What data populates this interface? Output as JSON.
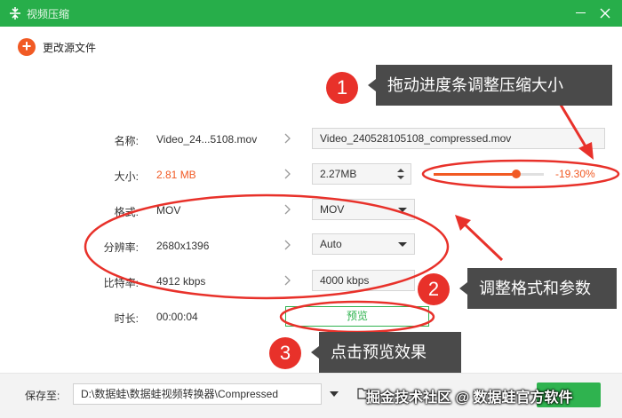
{
  "window": {
    "title": "视频压缩",
    "app_icon": "compress-icon",
    "accent": "#27ae4a"
  },
  "toolbar": {
    "change_source_label": "更改源文件"
  },
  "form": {
    "name": {
      "label": "名称:",
      "source": "Video_24...5108.mov",
      "output": "Video_240528105108_compressed.mov"
    },
    "size": {
      "label": "大小:",
      "source": "2.81 MB",
      "output": "2.27MB",
      "slider_percent": "-19.30%",
      "slider_fraction": 0.75
    },
    "format": {
      "label": "格式:",
      "source": "MOV",
      "output": "MOV"
    },
    "resolution": {
      "label": "分辨率:",
      "source": "2680x1396",
      "output": "Auto"
    },
    "bitrate": {
      "label": "比特率:",
      "source": "4912 kbps",
      "output": "4000 kbps"
    },
    "duration": {
      "label": "时长:",
      "source": "00:00:04"
    },
    "preview_label": "预览"
  },
  "bottom": {
    "save_label": "保存至:",
    "path": "D:\\数据蛙\\数据蛙视频转换器\\Compressed"
  },
  "callouts": [
    {
      "number": "1",
      "text": "拖动进度条调整压缩大小"
    },
    {
      "number": "2",
      "text": "调整格式和参数"
    },
    {
      "number": "3",
      "text": "点击预览效果"
    }
  ],
  "watermark": "掘金技术社区 @ 数据蛙官方软件",
  "colors": {
    "orange": "#f15a24",
    "annotation_red": "#e8312a",
    "callout_bg": "#4a4a4a"
  }
}
